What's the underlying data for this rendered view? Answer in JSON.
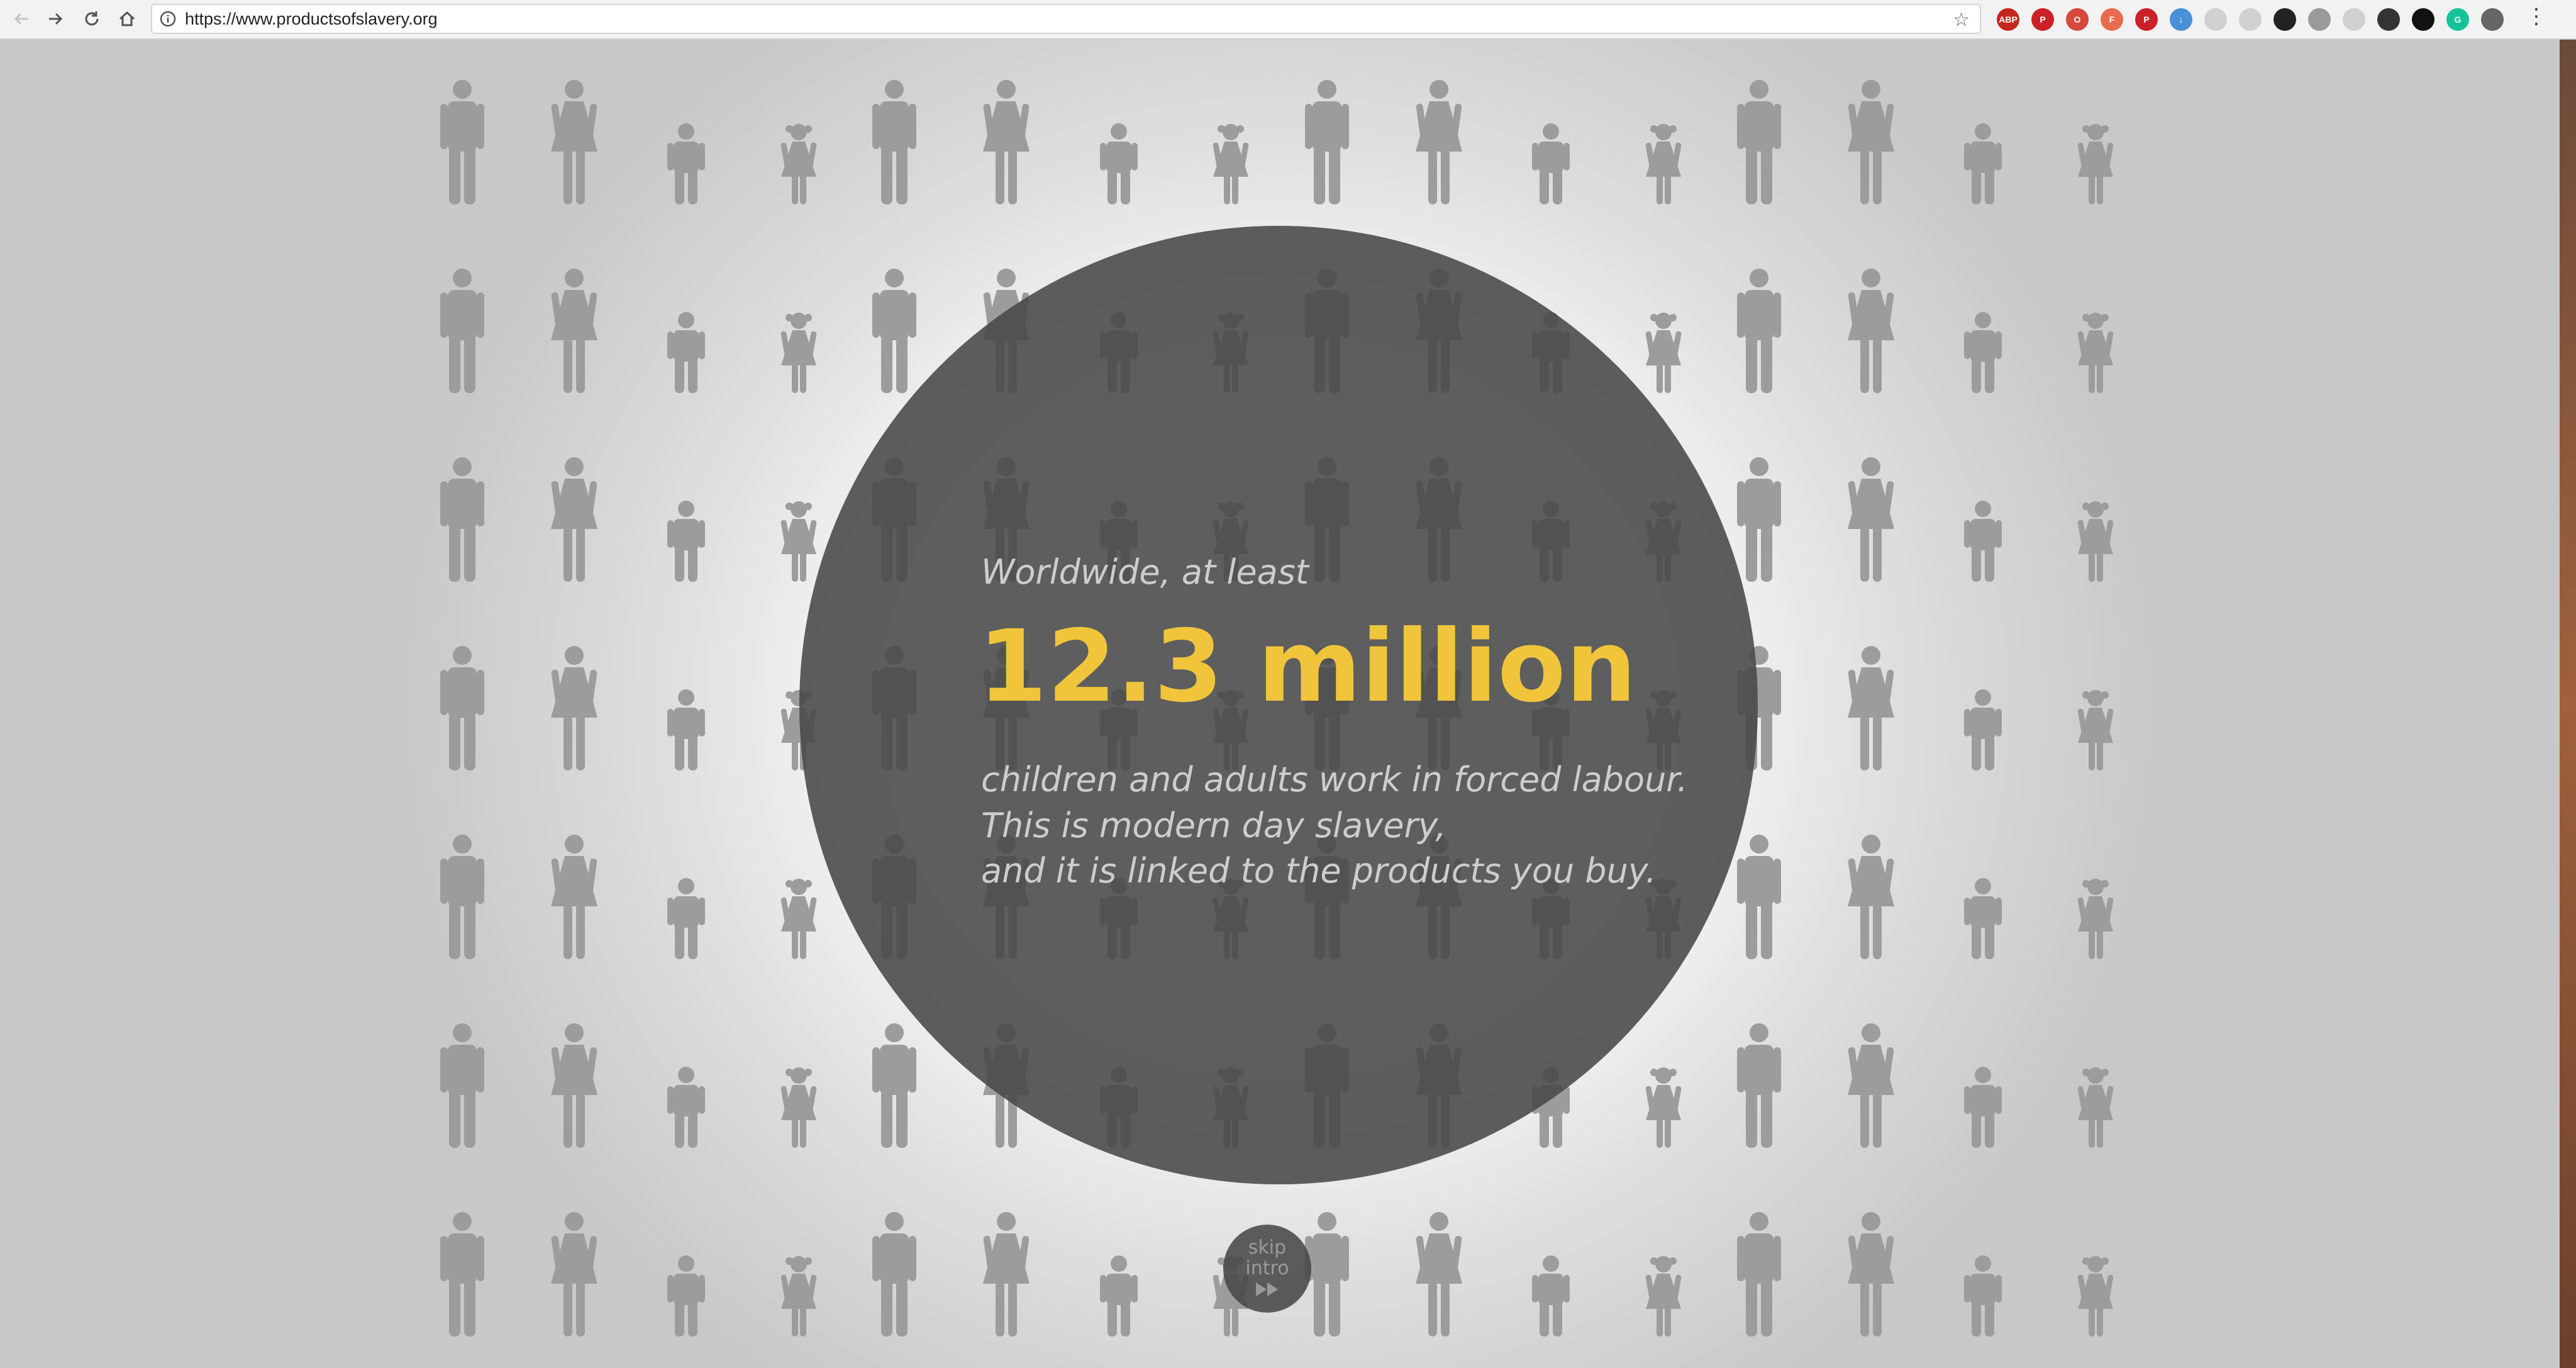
{
  "browser": {
    "url": "https://www.productsofslavery.org",
    "back_icon": "arrow-left-icon",
    "forward_icon": "arrow-right-icon",
    "reload_icon": "reload-icon",
    "home_icon": "home-icon",
    "bookmark_icon": "star-icon",
    "menu_icon": "kebab-menu-icon",
    "extensions": [
      {
        "name": "adblock-plus-icon",
        "label": "ABP",
        "color": "#c4261d"
      },
      {
        "name": "pinterest-icon",
        "label": "P",
        "color": "#cb2027"
      },
      {
        "name": "opera-icon",
        "label": "O",
        "color": "#d6493c"
      },
      {
        "name": "feedly-icon",
        "label": "F",
        "color": "#e86c4c"
      },
      {
        "name": "pinterest-save-icon",
        "label": "P",
        "color": "#cb2027"
      },
      {
        "name": "download-icon",
        "label": "↓",
        "color": "#4a90d9"
      },
      {
        "name": "comment-icon",
        "label": "",
        "color": "#d0d0d0"
      },
      {
        "name": "dropbox-icon",
        "label": "",
        "color": "#d0d0d0"
      },
      {
        "name": "cursor-icon",
        "label": "",
        "color": "#222222"
      },
      {
        "name": "camera-icon",
        "label": "",
        "color": "#9a9a9a"
      },
      {
        "name": "screenshot-icon",
        "label": "",
        "color": "#d0d0d0"
      },
      {
        "name": "eye-icon",
        "label": "",
        "color": "#333333"
      },
      {
        "name": "lastpass-icon",
        "label": "",
        "color": "#111111"
      },
      {
        "name": "grammarly-icon",
        "label": "G",
        "color": "#15c39a"
      },
      {
        "name": "globe-icon",
        "label": "",
        "color": "#666666"
      }
    ]
  },
  "intro": {
    "lead": "Worldwide, at least",
    "headline": "12.3 million",
    "line1": "children and adults work in forced labour.",
    "line2": "This is modern day slavery,",
    "line3": "and it is linked to the products you buy."
  },
  "skip": {
    "line1": "skip",
    "line2": "intro",
    "icon": "fast-forward-icon"
  },
  "colors": {
    "accent": "#f0c53b",
    "circle": "#484848",
    "figure": "#9c9c9c",
    "text": "#cdcdcd"
  }
}
